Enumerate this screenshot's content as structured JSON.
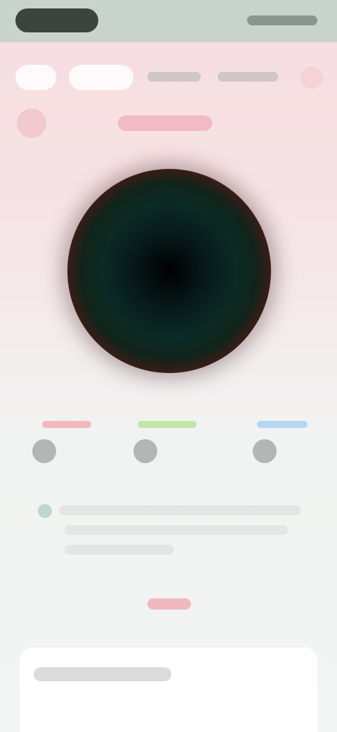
{
  "status_bar": {},
  "tabs": [
    {
      "name": "tab-1"
    },
    {
      "name": "tab-2"
    },
    {
      "name": "tab-3"
    },
    {
      "name": "tab-4"
    }
  ],
  "header": {},
  "options": [
    {
      "accent": "#f4a9b2"
    },
    {
      "accent": "#b9e49a"
    },
    {
      "accent": "#a9d1f2"
    }
  ],
  "colors": {
    "background_top": "#f6dde0",
    "background_bottom": "#f3f5f4",
    "dial_center": "#000000",
    "dial_ring": "#3a1c18",
    "link_red": "#f0a6ad"
  },
  "icons": {
    "back": "back-icon",
    "close": "close-icon",
    "info": "info-icon"
  }
}
